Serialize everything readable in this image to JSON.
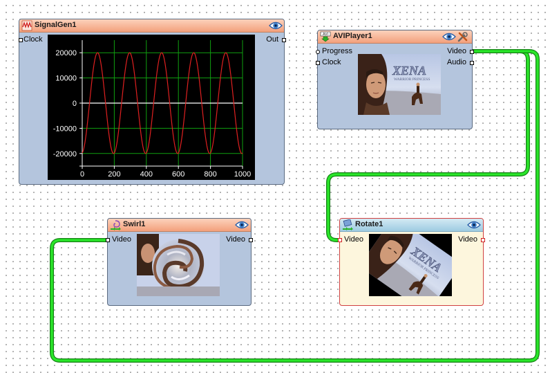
{
  "nodes": {
    "signalgen": {
      "title": "SignalGen1",
      "inputs": [
        "Clock"
      ],
      "outputs": [
        "Out"
      ]
    },
    "aviplayer": {
      "title": "AVIPlayer1",
      "inputs": [
        "Progress",
        "Clock"
      ],
      "outputs": [
        "Video",
        "Audio"
      ],
      "preview_logo": "XENA",
      "preview_sub": "WARRIOR PRINCESS"
    },
    "swirl": {
      "title": "Swirl1",
      "inputs": [
        "Video"
      ],
      "outputs": [
        "Video"
      ]
    },
    "rotate": {
      "title": "Rotate1",
      "inputs": [
        "Video"
      ],
      "outputs": [
        "Video"
      ],
      "preview_logo": "XENA",
      "preview_sub": "WARRIOR PRINCESS"
    }
  },
  "chart_data": {
    "type": "line",
    "series": [
      {
        "function": "20000*sin(2*pi*x/200 - 1.43)",
        "samples": 1000
      }
    ],
    "xlim": [
      0,
      1000
    ],
    "ylim": [
      -25000,
      25000
    ],
    "xticks": [
      "0",
      "200",
      "400",
      "600",
      "800",
      "1000"
    ],
    "yticks": [
      "20000",
      "10000",
      "0",
      "-10000",
      "-20000"
    ],
    "grid": true,
    "line_color": "#e02020",
    "grid_color": "#10a010",
    "background": "#000000",
    "title": "",
    "xlabel": "",
    "ylabel": ""
  },
  "colors": {
    "wire": "#22dd22",
    "header": "#f3a07c",
    "header_selected": "#9dcbe2",
    "node_body": "#b4c5dd",
    "node_body_selected": "#fdf6dd"
  },
  "icons": {
    "signalgen": "waveform-icon",
    "aviplayer": "avi-download-icon",
    "swirl": "swirl-effect-icon",
    "rotate": "rotate-effect-icon",
    "preview": "eye-icon",
    "properties": "tools-icon"
  }
}
